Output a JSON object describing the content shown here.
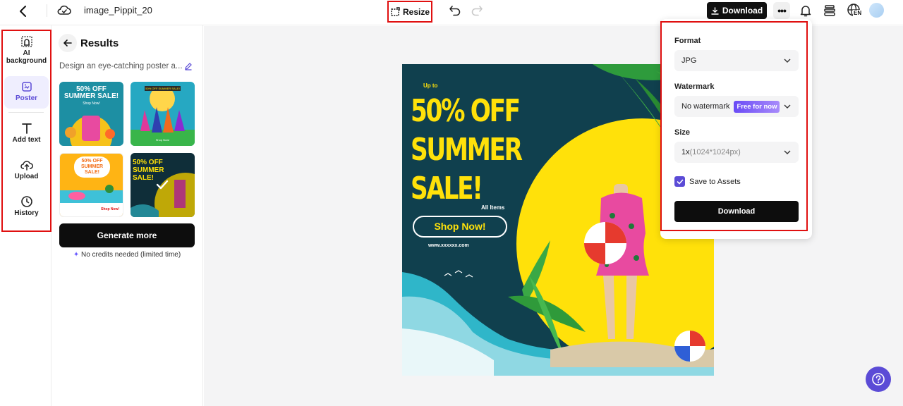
{
  "topbar": {
    "filename": "image_Pippit_20",
    "resize_label": "Resize",
    "download_label": "Download",
    "language": "EN"
  },
  "leftnav": {
    "items": [
      {
        "label": "AI background"
      },
      {
        "label": "Poster"
      },
      {
        "label": "Add text"
      },
      {
        "label": "Upload"
      },
      {
        "label": "History"
      }
    ]
  },
  "results": {
    "title": "Results",
    "prompt": "Design an eye-catching poster a...",
    "generate_label": "Generate more",
    "credits_note": "No credits needed (limited time)",
    "thumbs": [
      {
        "headline": "50% OFF SUMMER SALE!",
        "cta": "Shop Now!"
      },
      {
        "headline": "50% OFF SUMMER SALE!",
        "cta": "Shop Now!"
      },
      {
        "headline": "50% OFF SUMMER SALE!",
        "cta": "Shop Now!"
      },
      {
        "headline": "50% OFF SUMMER SALE!"
      }
    ]
  },
  "poster": {
    "up_to": "Up to",
    "line1": "50% OFF",
    "line2": "SUMMER",
    "line3": "SALE!",
    "all_items": "All Items",
    "cta": "Shop Now!",
    "website": "www.xxxxxx.com",
    "colors": {
      "bg": "#10404e",
      "accent": "#ffe10a",
      "sea": "#2fb6c9"
    }
  },
  "download_panel": {
    "format_label": "Format",
    "format_value": "JPG",
    "watermark_label": "Watermark",
    "watermark_value": "No watermark",
    "watermark_badge": "Free for now",
    "size_label": "Size",
    "size_value": "1x",
    "size_detail": "(1024*1024px)",
    "save_label": "Save to Assets",
    "save_checked": true,
    "download_label": "Download"
  },
  "colors": {
    "highlight": "#e01010",
    "brand": "#5b4bd6"
  }
}
